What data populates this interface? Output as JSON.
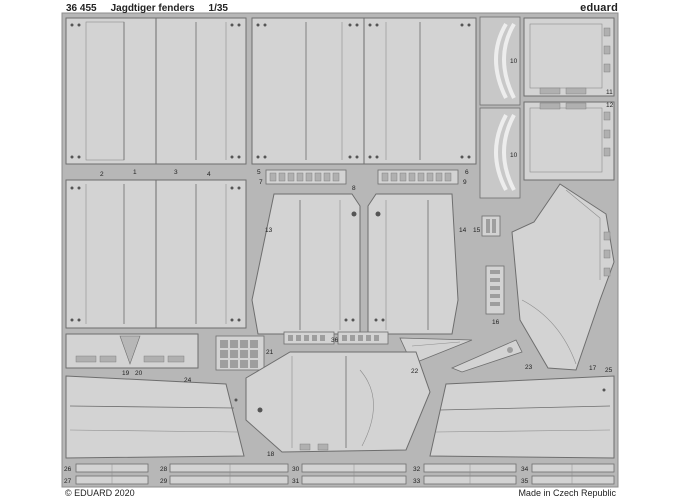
{
  "header": {
    "code": "36 455",
    "title": "Jagdtiger fenders",
    "scale": "1/35",
    "brand": "eduard"
  },
  "footer": {
    "copyright": "© EDUARD 2020",
    "origin": "Made in Czech Republic"
  },
  "colors": {
    "fret": "#b7b7b7",
    "part": "#d3d3d3",
    "outline": "#6e6e6e",
    "dark": "#8d8d8d"
  },
  "part_numbers": [
    "1",
    "2",
    "3",
    "4",
    "5",
    "6",
    "7",
    "8",
    "9",
    "10",
    "10",
    "11",
    "12",
    "13",
    "14",
    "15",
    "16",
    "17",
    "18",
    "19",
    "20",
    "21",
    "22",
    "23",
    "24",
    "25",
    "26",
    "27",
    "28",
    "29",
    "30",
    "31",
    "32",
    "33",
    "34",
    "35",
    "36"
  ]
}
